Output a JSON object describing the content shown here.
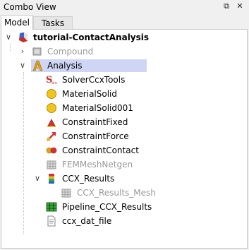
{
  "window": {
    "title": "Combo View"
  },
  "tabs": [
    {
      "label": "Model"
    },
    {
      "label": "Tasks"
    }
  ],
  "tree": {
    "root": {
      "label": "tutorial-ContactAnalysis"
    },
    "compound": {
      "label": "Compound"
    },
    "analysis": {
      "label": "Analysis"
    },
    "children": [
      {
        "label": "SolverCcxTools"
      },
      {
        "label": "MaterialSolid"
      },
      {
        "label": "MaterialSolid001"
      },
      {
        "label": "ConstraintFixed"
      },
      {
        "label": "ConstraintForce"
      },
      {
        "label": "ConstraintContact"
      },
      {
        "label": "FEMMeshNetgen"
      },
      {
        "label": "CCX_Results"
      },
      {
        "label": "CCX_Results_Mesh"
      },
      {
        "label": "Pipeline_CCX_Results"
      },
      {
        "label": "ccx_dat_file"
      }
    ]
  },
  "colors": {
    "selection": "#cfd6f5",
    "disabled_text": "#9a9a9a"
  }
}
